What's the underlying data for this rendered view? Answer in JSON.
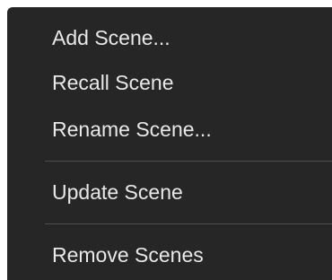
{
  "menu": {
    "items": [
      {
        "label": "Add Scene..."
      },
      {
        "label": "Recall Scene"
      },
      {
        "label": "Rename Scene..."
      },
      {
        "label": "Update Scene"
      },
      {
        "label": "Remove Scenes"
      }
    ]
  },
  "colors": {
    "menu_background": "#262626",
    "item_text": "#e8e8e8",
    "separator": "#4d4d4d",
    "page_background": "#ffffff"
  }
}
